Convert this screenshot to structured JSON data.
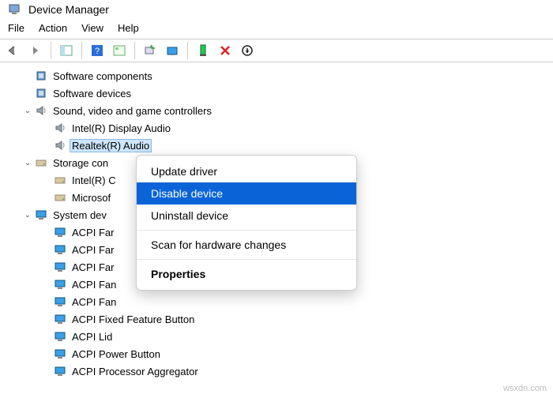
{
  "window": {
    "title": "Device Manager"
  },
  "menubar": {
    "items": [
      "File",
      "Action",
      "View",
      "Help"
    ]
  },
  "toolbar_icons": [
    "back",
    "forward",
    "sep",
    "panel",
    "sep",
    "help",
    "wizard",
    "sep",
    "scan",
    "monitor",
    "sep",
    "device",
    "delete",
    "update"
  ],
  "tree": [
    {
      "depth": 1,
      "toggle": "",
      "icon": "chip",
      "label": "Software components"
    },
    {
      "depth": 1,
      "toggle": "",
      "icon": "chip",
      "label": "Software devices"
    },
    {
      "depth": 1,
      "toggle": "v",
      "icon": "speaker",
      "label": "Sound, video and game controllers"
    },
    {
      "depth": 2,
      "toggle": "",
      "icon": "speaker",
      "label": "Intel(R) Display Audio"
    },
    {
      "depth": 2,
      "toggle": "",
      "icon": "speaker",
      "label": "Realtek(R) Audio",
      "selected": true
    },
    {
      "depth": 1,
      "toggle": "v",
      "icon": "drive",
      "label": "Storage con"
    },
    {
      "depth": 2,
      "toggle": "",
      "icon": "drive",
      "label": "Intel(R) C"
    },
    {
      "depth": 2,
      "toggle": "",
      "icon": "drive",
      "label": "Microsof"
    },
    {
      "depth": 1,
      "toggle": "v",
      "icon": "pc",
      "label": "System dev"
    },
    {
      "depth": 2,
      "toggle": "",
      "icon": "pc",
      "label": "ACPI Far"
    },
    {
      "depth": 2,
      "toggle": "",
      "icon": "pc",
      "label": "ACPI Far"
    },
    {
      "depth": 2,
      "toggle": "",
      "icon": "pc",
      "label": "ACPI Far"
    },
    {
      "depth": 2,
      "toggle": "",
      "icon": "pc",
      "label": "ACPI Fan"
    },
    {
      "depth": 2,
      "toggle": "",
      "icon": "pc",
      "label": "ACPI Fan"
    },
    {
      "depth": 2,
      "toggle": "",
      "icon": "pc",
      "label": "ACPI Fixed Feature Button"
    },
    {
      "depth": 2,
      "toggle": "",
      "icon": "pc",
      "label": "ACPI Lid"
    },
    {
      "depth": 2,
      "toggle": "",
      "icon": "pc",
      "label": "ACPI Power Button"
    },
    {
      "depth": 2,
      "toggle": "",
      "icon": "pc",
      "label": "ACPI Processor Aggregator"
    }
  ],
  "context_menu": {
    "items": [
      {
        "label": "Update driver",
        "type": "item"
      },
      {
        "label": "Disable device",
        "type": "hover"
      },
      {
        "label": "Uninstall device",
        "type": "item"
      },
      {
        "type": "sep"
      },
      {
        "label": "Scan for hardware changes",
        "type": "item"
      },
      {
        "type": "sep"
      },
      {
        "label": "Properties",
        "type": "bold"
      }
    ]
  },
  "watermark": "wsxdn.com"
}
